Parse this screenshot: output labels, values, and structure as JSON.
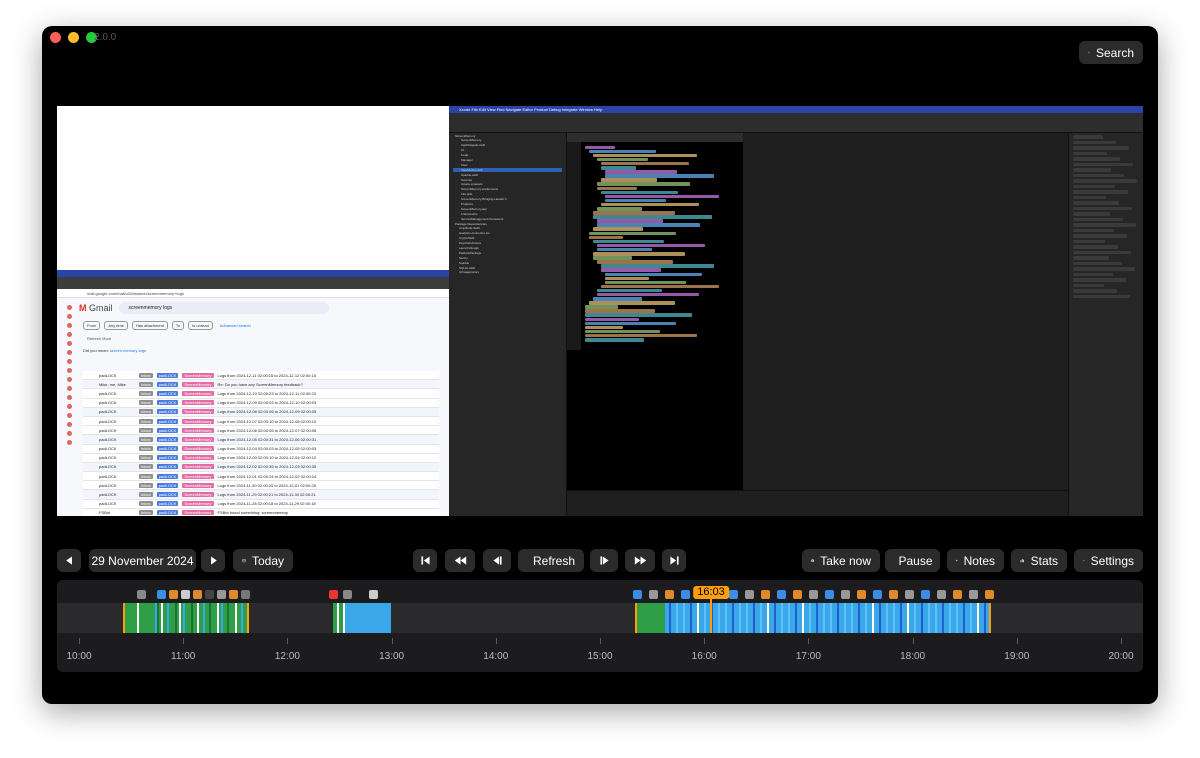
{
  "window": {
    "version": "2.0.0"
  },
  "header": {
    "search_label": "Search"
  },
  "preview": {
    "chrome_url": "mail.google.com/mail/u/0/#search/screenmemory+logs",
    "gmail_name": "Gmail",
    "gmail_search": "screenmemory logs",
    "filters": [
      "From",
      "Any time",
      "Has attachment",
      "To",
      "Is unread",
      "Advanced search"
    ],
    "list_sub": "Refresh   More",
    "did_you_mean_prefix": "Did you mean:",
    "did_you_mean_term": "screen memory logs",
    "rows": [
      "Logs from 2024-12-11 02:00:15 to 2024-12-12 02:00:15",
      "Re: Do you have any ScreenMemory feedback?",
      "Logs from 2024-12-10 02:00:23 to 2024-12-11 02:00:23",
      "Logs from 2024-12-09 02:00:03 to 2024-12-10 02:00:03",
      "Logs from 2024-12-08 02:00:05 to 2024-12-09 02:00:05",
      "Logs from 2024-12-07 02:00:10 to 2024-12-08 02:00:10",
      "Logs from 2024-12-06 02:00:05 to 2024-12-07 02:00:05",
      "Logs from 2024-12-05 02:00:31 to 2024-12-06 02:00:31",
      "Logs from 2024-12-04 02:00:03 to 2024-12-05 02:00:03",
      "Logs from 2024-12-03 02:00:10 to 2024-12-04 02:00:10",
      "Logs from 2024-12-02 02:00:35 to 2024-12-03 02:00:35",
      "Logs from 2024-12-01 02:00:24 to 2024-12-02 02:00:24",
      "Logs from 2024-11-30 02:00:25 to 2024-12-01 02:00:25",
      "Logs from 2024-11-29 02:00:21 to 2024-11-30 02:00:21",
      "Logs from 2024-11-28 02:00:18 to 2024-11-29 02:00:18",
      "FSBot found something: screenmemory"
    ],
    "senders": [
      "padLOCK",
      "Mike, me, Mike",
      "padLOCK",
      "padLOCK",
      "padLOCK",
      "padLOCK",
      "padLOCK",
      "padLOCK",
      "padLOCK",
      "padLOCK",
      "padLOCK",
      "padLOCK",
      "padLOCK",
      "padLOCK",
      "padLOCK",
      "FSBot"
    ],
    "label_inbox": "Inbox",
    "label_padlock": "padLOCK",
    "label_app": "ScreenMemory",
    "xcode_menu": "Xcode  File  Edit  View  Find  Navigate  Editor  Product  Debug  Integrate  Window  Help",
    "nav_items": [
      "ScreenMemory",
      "ScreenMemory",
      "AppDelegate.swift",
      "UI",
      "Code",
      "Manager",
      "View",
      "ViewModel.swift",
      "Sparkle.swift",
      "Sources",
      "Assets.xcassets",
      "ScreenMemory.entitlements",
      "Info.plist",
      "ScreenMemory-Bridging-Header.h",
      "Products",
      "ScreenMemory.app",
      "Frameworks",
      "ServiceManagement.framework",
      "Package Dependencies",
      "Amplitude-Swift",
      "analytics-connector-ios",
      "CryptoSwift",
      "KeychainAccess",
      "LaunchAtLogin",
      "PadlockPackage",
      "Sentry",
      "Sparkle",
      "SQLite.swift",
      "UIImageColors"
    ]
  },
  "controls": {
    "date": "29 November 2024",
    "today": "Today",
    "refresh": "Refresh",
    "take_now": "Take now",
    "pause": "Pause",
    "notes": "Notes",
    "stats": "Stats",
    "settings": "Settings"
  },
  "timeline": {
    "cursor_time": "16:03",
    "ticks": [
      "10:00",
      "11:00",
      "12:00",
      "13:00",
      "14:00",
      "15:00",
      "16:00",
      "17:00",
      "18:00",
      "19:00",
      "20:00"
    ]
  },
  "colors": {
    "accent_orange": "#ff9f0a",
    "activity_green": "#2e9e47",
    "activity_blue": "#3aa7e8"
  }
}
